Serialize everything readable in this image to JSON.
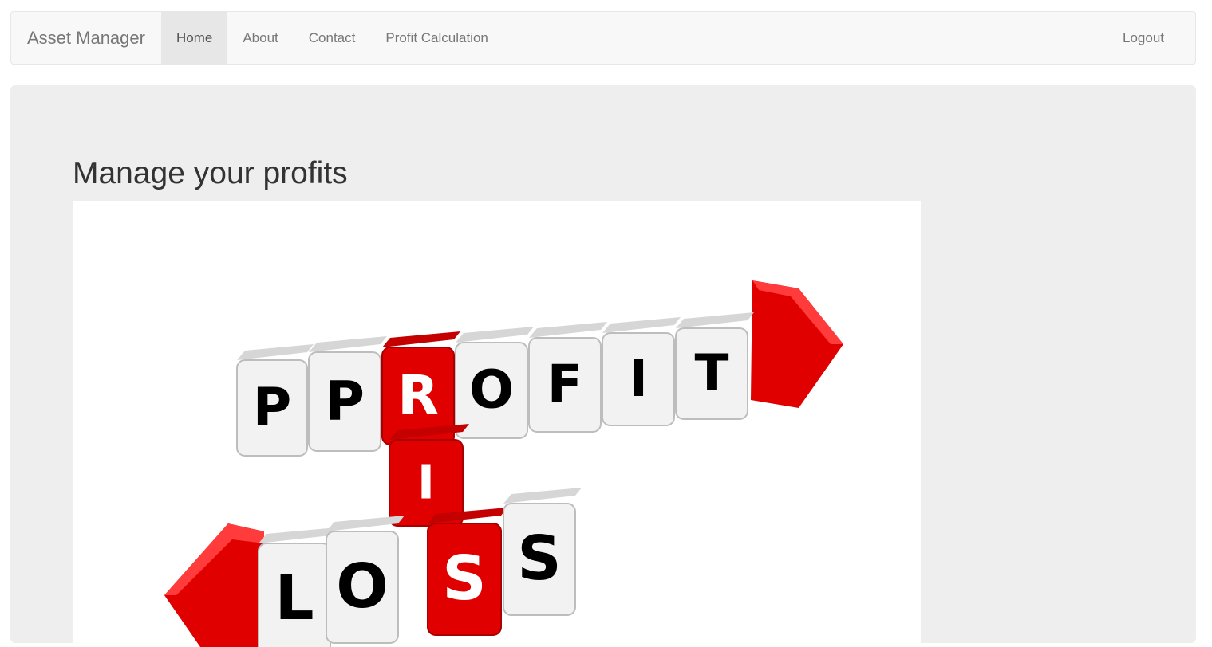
{
  "navbar": {
    "brand": "Asset Manager",
    "items": [
      {
        "label": "Home",
        "active": true
      },
      {
        "label": "About",
        "active": false
      },
      {
        "label": "Contact",
        "active": false
      },
      {
        "label": "Profit Calculation",
        "active": false
      }
    ],
    "logout_label": "Logout"
  },
  "main": {
    "title": "Manage your profits",
    "image": {
      "subject": "profit-risk-loss-cubes",
      "word_profit": [
        "P",
        "R",
        "O",
        "F",
        "I",
        "T"
      ],
      "word_risk": [
        "R",
        "I",
        "S"
      ],
      "word_loss": [
        "L",
        "O",
        "S",
        "S"
      ]
    }
  },
  "colors": {
    "navbar_bg": "#f8f8f8",
    "active_bg": "#e7e7e7",
    "jumbotron_bg": "#eeeeee",
    "cube_red": "#e00000",
    "cube_white": "#f2f2f2"
  }
}
